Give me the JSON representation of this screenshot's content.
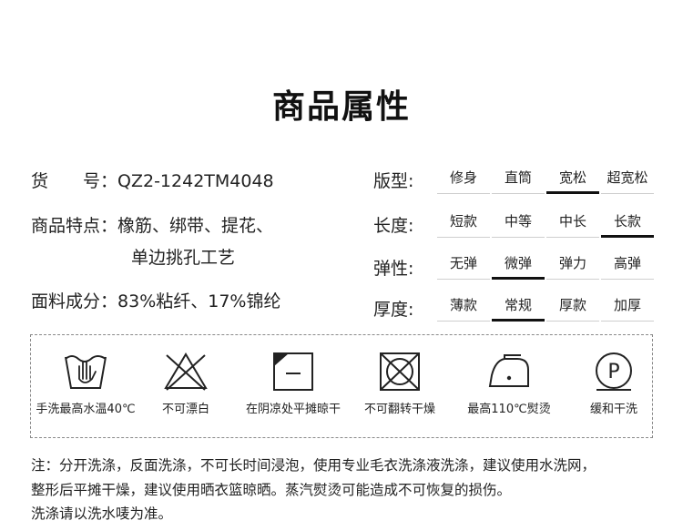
{
  "title": "商品属性",
  "left": {
    "item_no": {
      "label": "货　　号：",
      "value": "QZ2-1242TM4048"
    },
    "features": {
      "label": "商品特点：",
      "line1": "橡筋、绑带、提花、",
      "line2": "单边挑孔工艺"
    },
    "fabric": {
      "label": "面料成分：",
      "value": "83%粘纤、17%锦纶"
    }
  },
  "attributes": {
    "fit": {
      "label": "版型:",
      "options": [
        "修身",
        "直筒",
        "宽松",
        "超宽松"
      ],
      "selected": 2
    },
    "length": {
      "label": "长度:",
      "options": [
        "短款",
        "中等",
        "中长",
        "长款"
      ],
      "selected": 3
    },
    "elastic": {
      "label": "弹性:",
      "options": [
        "无弹",
        "微弹",
        "弹力",
        "高弹"
      ],
      "selected": 1
    },
    "thickness": {
      "label": "厚度:",
      "options": [
        "薄款",
        "常规",
        "厚款",
        "加厚"
      ],
      "selected": 1
    }
  },
  "care": [
    {
      "icon": "hand-wash-icon",
      "caption": "手洗最高水温40℃"
    },
    {
      "icon": "no-bleach-icon",
      "caption": "不可漂白"
    },
    {
      "icon": "shade-dry-flat-icon",
      "caption": "在阴凉处平摊晾干"
    },
    {
      "icon": "no-tumble-dry-icon",
      "caption": "不可翻转干燥"
    },
    {
      "icon": "iron-medium-icon",
      "caption": "最高110℃熨烫"
    },
    {
      "icon": "dry-clean-p-icon",
      "caption": "缓和干洗"
    }
  ],
  "notes": [
    "注：分开洗涤，反面洗涤，不可长时间浸泡，使用专业毛衣洗涤液洗涤，建议使用水洗网，",
    "整形后平摊干燥，建议使用晒衣篮晾晒。蒸汽熨烫可能造成不可恢复的损伤。",
    "洗涤请以洗水唛为准。"
  ]
}
